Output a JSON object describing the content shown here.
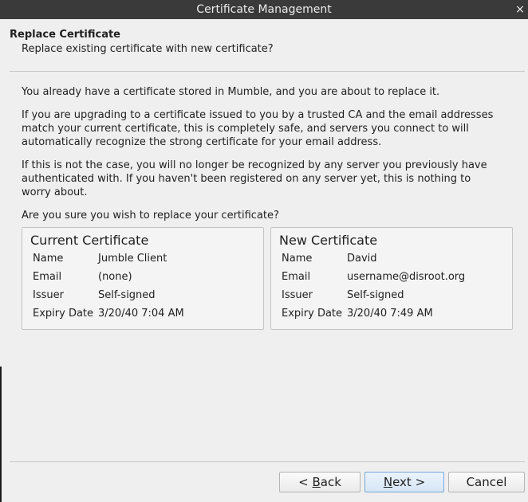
{
  "window": {
    "title": "Certificate Management",
    "close_glyph": "×"
  },
  "page": {
    "title": "Replace Certificate",
    "subtitle": "Replace existing certificate with new certificate?"
  },
  "paragraphs": [
    "You already have a certificate stored in Mumble, and you are about to replace it.",
    "If you are upgrading to a certificate issued to you by a trusted CA and the email addresses match your current certificate, this is completely safe, and servers you connect to will automatically recognize the strong certificate for your email address.",
    "If this is not the case, you will no longer be recognized by any server you previously have authenticated with. If you haven't been registered on any server yet, this is nothing to worry about.",
    "Are you sure you wish to replace your certificate?"
  ],
  "current": {
    "title": "Current Certificate",
    "rows": [
      {
        "label": "Name",
        "value": "Jumble Client"
      },
      {
        "label": "Email",
        "value": "(none)"
      },
      {
        "label": "Issuer",
        "value": "Self-signed"
      },
      {
        "label": "Expiry Date",
        "value": "3/20/40 7:04 AM"
      }
    ]
  },
  "new": {
    "title": "New Certificate",
    "rows": [
      {
        "label": "Name",
        "value": "David"
      },
      {
        "label": "Email",
        "value": "username@disroot.org"
      },
      {
        "label": "Issuer",
        "value": "Self-signed"
      },
      {
        "label": "Expiry Date",
        "value": "3/20/40 7:49 AM"
      }
    ]
  },
  "buttons": {
    "back": {
      "pre": "< ",
      "mnemonic": "B",
      "post": "ack"
    },
    "next": {
      "pre": "",
      "mnemonic": "N",
      "post": "ext >"
    },
    "cancel": "Cancel"
  },
  "colors": {
    "titlebar": "#3a3a3a",
    "window_bg": "#efefef",
    "default_button_border": "#7aa7d6"
  }
}
